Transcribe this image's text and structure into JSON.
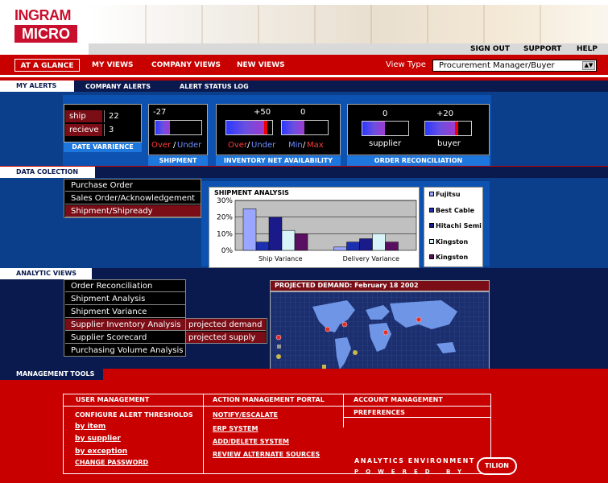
{
  "brand": {
    "logo_top": "INGRAM",
    "logo_bottom": "MICRO"
  },
  "utility": [
    "SIGN OUT",
    "SUPPORT",
    "HELP"
  ],
  "nav": {
    "items": [
      "AT A GLANCE",
      "MY VIEWS",
      "COMPANY VIEWS",
      "NEW VIEWS"
    ],
    "view_type_label": "View Type",
    "view_type_value": "Procurement Manager/Buyer"
  },
  "alerts": {
    "tabs": [
      "MY ALERTS",
      "COMPANY ALERTS",
      "ALERT STATUS LOG"
    ],
    "variance": {
      "rows": [
        {
          "label": "ship",
          "value": "22"
        },
        {
          "label": "recieve",
          "value": "3"
        }
      ],
      "caption": "DATE VARRIENCE"
    },
    "shipment": {
      "value": "-27",
      "label_a": "Over",
      "label_b": "Under",
      "caption": "SHIPMENT"
    },
    "inventory": {
      "value1": "+50",
      "value2": "0",
      "label_a": "Over",
      "label_b": "Under",
      "label_c": "Min",
      "label_d": "Max",
      "caption": "INVENTORY NET AVAILABILITY"
    },
    "reconciliation": {
      "value1": "0",
      "value2": "+20",
      "label1": "supplier",
      "label2": "buyer",
      "caption": "ORDER RECONCILIATION"
    }
  },
  "data_collection": {
    "tab": "DATA COLECTION",
    "items": [
      "Purchase Order",
      "Sales Order/Acknowledgement",
      "Shipment/Shipready"
    ],
    "selected_index": 2
  },
  "chart_data": {
    "type": "bar",
    "title": "SHIPMENT ANALYSIS",
    "categories": [
      "Ship Variance",
      "Delivery Variance"
    ],
    "ylim": [
      0,
      30
    ],
    "yticks": [
      "30%",
      "20%",
      "10%",
      "0%"
    ],
    "series": [
      {
        "name": "Fujitsu",
        "color": "#9aa6ff",
        "values": [
          25,
          2
        ]
      },
      {
        "name": "Best Cable",
        "color": "#1b2fb0",
        "values": [
          5,
          5
        ]
      },
      {
        "name": "Hitachi Semi",
        "color": "#1a1a8a",
        "values": [
          20,
          7
        ]
      },
      {
        "name": "Kingston",
        "color": "#d8f4f8",
        "values": [
          12,
          10
        ]
      },
      {
        "name": "Kingston",
        "color": "#5a1060",
        "values": [
          10,
          5
        ]
      }
    ],
    "legend_position": "right"
  },
  "analytic": {
    "tab": "ANALYTIC VIEWS",
    "items": [
      "Order Reconciliation",
      "Shipment Analysis",
      "Shipment Variance",
      "Supplier Inventory Analysis",
      "Supplier Scorecard",
      "Purchasing Volume Analysis"
    ],
    "sub_items": [
      "projected demand",
      "projected supply"
    ],
    "map_title": "PROJECTED DEMAND:  February 18  2002"
  },
  "management": {
    "tab": "MANAGEMENT TOOLS",
    "col1_header": "USER MANAGEMENT",
    "col1_items": [
      "CONFIGURE ALERT THRESHOLDS",
      "by item",
      "by supplier",
      "by exception",
      "CHANGE PASSWORD"
    ],
    "col2_header": "ACTION MANAGEMENT PORTAL",
    "col2_items": [
      "NOTIFY/ESCALATE",
      "ERP SYSTEM",
      "ADD/DELETE SYSTEM",
      "REVIEW ALTERNATE SOURCES"
    ],
    "col3_items": [
      "ACCOUNT MANAGEMENT",
      "PREFERENCES"
    ],
    "footer_line1": "ANALYTICS ENVIRONMENT",
    "footer_line2": "POWERED BY",
    "footer_logo": "TILION"
  }
}
